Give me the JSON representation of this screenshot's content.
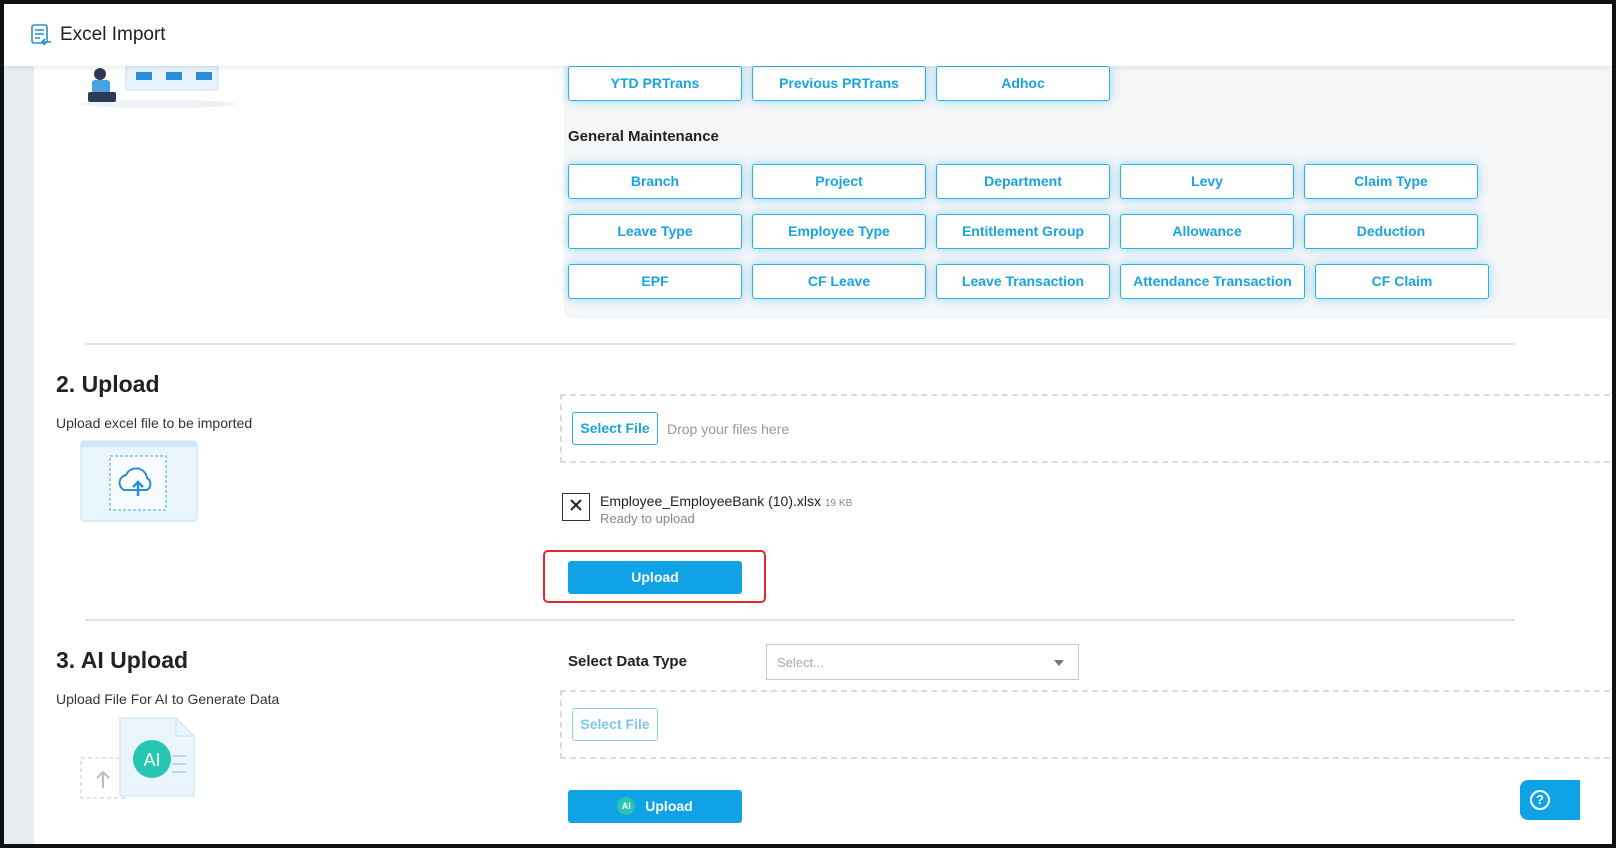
{
  "header": {
    "title": "Excel Import",
    "icon": "document-import-icon"
  },
  "types_top": [
    "YTD PRTrans",
    "Previous PRTrans",
    "Adhoc"
  ],
  "general_maintenance": {
    "title": "General Maintenance",
    "row1": [
      "Branch",
      "Project",
      "Department",
      "Levy",
      "Claim Type"
    ],
    "row2": [
      "Leave Type",
      "Employee Type",
      "Entitlement Group",
      "Allowance",
      "Deduction"
    ],
    "row3": [
      "EPF",
      "CF Leave",
      "Leave Transaction",
      "Attendance Transaction",
      "CF Claim"
    ]
  },
  "upload": {
    "title": "2. Upload",
    "subtitle": "Upload excel file to be imported",
    "select_file": "Select File",
    "drop_text": "Drop your files here",
    "file": {
      "name": "Employee_EmployeeBank (10).xlsx",
      "size": "19 KB",
      "status": "Ready to upload"
    },
    "button": "Upload"
  },
  "ai_upload": {
    "title": "3. AI Upload",
    "subtitle": "Upload File For AI to Generate Data",
    "data_type_label": "Select Data Type",
    "select_placeholder": "Select...",
    "select_file": "Select File",
    "ai_badge": "AI",
    "button": "Upload"
  },
  "colors": {
    "accent": "#0fa3e6",
    "highlight": "#e02b2b",
    "ai": "#26c6b0"
  }
}
